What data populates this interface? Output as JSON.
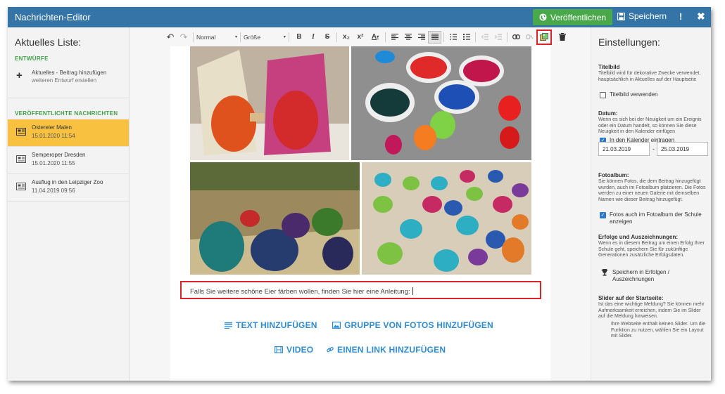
{
  "app": {
    "title": "Nachrichten-Editor"
  },
  "header": {
    "publish_label": "Veröffentlichen",
    "save_label": "Speichern",
    "more_label": "!",
    "close_label": "✖"
  },
  "left": {
    "title": "Aktuelles Liste:",
    "drafts_heading": "ENTWÜRFE",
    "draft_add": {
      "label": "Aktuelles - Beitrag hinzufügen",
      "sub": "weiteren Entwurf erstellen"
    },
    "published_heading": "VERÖFFENTLICHTE NACHRICHTEN",
    "items": [
      {
        "title": "Ostereier Malen",
        "date": "15.01.2020 11:54"
      },
      {
        "title": "Semperoper Dresden",
        "date": "15.01.2020 11:55"
      },
      {
        "title": "Ausflug in den Leipziger Zoo",
        "date": "11.04.2019 09:56"
      }
    ]
  },
  "toolbar": {
    "style_select": "Normal",
    "size_select": "Größe",
    "bold": "B",
    "italic": "I",
    "strike": "S",
    "sub": "x₂",
    "sup": "x²",
    "color": "A"
  },
  "editor": {
    "paragraph": "Falls Sie weitere schöne Eier färben wollen, finden Sie hier eine Anleitung:",
    "add_text": "TEXT HINZUFÜGEN",
    "add_photos": "GRUPPE VON FOTOS HINZUFÜGEN",
    "add_video": "VIDEO",
    "add_link": "EINEN LINK HINZUFÜGEN"
  },
  "right": {
    "title": "Einstellungen:",
    "titlebild": {
      "heading": "Titelbild",
      "desc": "Titelbild wird für dekorative Zwecke verwendet, hauptsächlich in Aktuelles auf der Hauptseite",
      "checkbox": "Titelbild verwenden"
    },
    "datum": {
      "heading": "Datum:",
      "desc": "Wenn es sich bei der Neuigkeit um ein Ereignis oder ein Datum handelt, so können Sie diese Neuigkeit in den Kalender einfügen",
      "checkbox": "In den Kalender eintragen",
      "from": "21.03.2019",
      "separator": "-",
      "to": "25.03.2019"
    },
    "fotoalbum": {
      "heading": "Fotoalbum:",
      "desc": "Sie können Fotos, die dem Beitrag hinzugefügt wurden, auch im Fotoalbum platzieren. Die Fotos werden zu einer neuen Galerie mit demselben Namen wie dieser Beitrag hinzugefügt.",
      "checkbox_l1": "Fotos auch im Fotoalbum der Schule",
      "checkbox_l2": "anzeigen"
    },
    "erfolge": {
      "heading": "Erfolge und Auszeichnungen:",
      "desc": "Wenn es in diesem Beitrag um einen Erfolg Ihrer Schule geht, speichern Sie für zukünftige Generationen zusätzliche Erfolgsdaten.",
      "link_l1": "Speichern in Erfolgen /",
      "link_l2": "Auszeichnungen"
    },
    "slider": {
      "heading": "Slider auf der Startseite:",
      "desc": "Ist das eine wichtige Meldung? Sie können mehr Aufmerksamkeit erreichen, indem Sie im Slider auf die Meldung hinweisen.",
      "note": "Ihre Webseite enthält keinen Slider. Um die Funktion zu nutzen, wählen Sie ein Layout mit Slider."
    }
  },
  "colors": {
    "header": "#3474a7",
    "publish": "#49a84a",
    "active_item": "#f8c140",
    "link": "#2f8cd0",
    "highlight": "#d9242a",
    "section_green": "#41a048"
  }
}
